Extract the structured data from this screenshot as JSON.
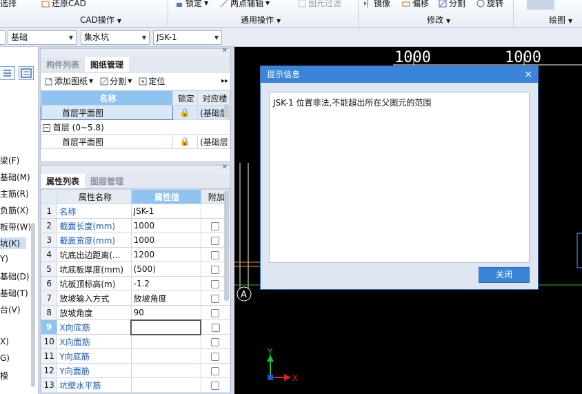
{
  "ribbon": {
    "cad_group": {
      "top_item": "还原CAD",
      "left_fragment": "选择",
      "label": "CAD操作"
    },
    "general_group": {
      "lock": "锁定",
      "two_point_paste": "两点辅轴",
      "element_filter": "图元过滤",
      "label": "通用操作"
    },
    "modify_group": {
      "mirror": "镜像",
      "offset": "偏移",
      "split": "分割",
      "rotate": "旋转",
      "label": "修改"
    },
    "draw_group": {
      "label": "绘图"
    }
  },
  "dropdowns": [
    {
      "value": ""
    },
    {
      "value": "基础"
    },
    {
      "value": "集水坑"
    },
    {
      "value": "JSK-1"
    }
  ],
  "left_tree": {
    "items": [
      "梁(F)",
      "基础(M)",
      "主筋(R)",
      "负筋(X)",
      "板带(W)",
      "坑(K)",
      "Y)",
      "基础(D)",
      "基础(T)",
      "台(V)",
      "X)",
      "G)",
      "模"
    ]
  },
  "drawing_panel": {
    "tabs": [
      "构件列表",
      "图纸管理"
    ],
    "toolbar": {
      "add_drawing": "添加图纸",
      "split": "分割",
      "locate": "定位"
    },
    "columns": [
      "名称",
      "锁定",
      "对应楼"
    ],
    "rows": [
      {
        "name": "首层平面图",
        "lock": "🔒",
        "floor": "(基础层"
      },
      {
        "group": "首层 (0~5.8)"
      },
      {
        "name": "首层平面图",
        "lock": "🔒",
        "floor": "(基础层"
      }
    ]
  },
  "property_panel": {
    "tabs": [
      "属性列表",
      "图层管理"
    ],
    "columns": [
      "属性名称",
      "属性值",
      "附加"
    ],
    "rows": [
      {
        "num": "1",
        "name": "名称",
        "value": "JSK-1",
        "blue": true,
        "check": false
      },
      {
        "num": "2",
        "name": "截面长度(mm)",
        "value": "1000",
        "blue": true,
        "check": true
      },
      {
        "num": "3",
        "name": "截面宽度(mm)",
        "value": "1000",
        "blue": true,
        "check": true
      },
      {
        "num": "4",
        "name": "坑底出边距离(...",
        "value": "1200",
        "blue": false,
        "check": true
      },
      {
        "num": "5",
        "name": "坑底板厚度(mm)",
        "value": "(500)",
        "blue": false,
        "check": true
      },
      {
        "num": "6",
        "name": "坑板顶标高(m)",
        "value": "-1.2",
        "blue": false,
        "check": true
      },
      {
        "num": "7",
        "name": "放坡输入方式",
        "value": "放坡角度",
        "blue": false,
        "check": true
      },
      {
        "num": "8",
        "name": "放坡角度",
        "value": "90",
        "blue": false,
        "check": true
      },
      {
        "num": "9",
        "name": "X向底筋",
        "value": "",
        "blue": true,
        "check": true
      },
      {
        "num": "10",
        "name": "X向面筋",
        "value": "",
        "blue": true,
        "check": true
      },
      {
        "num": "11",
        "name": "Y向底筋",
        "value": "",
        "blue": true,
        "check": true
      },
      {
        "num": "12",
        "name": "Y向面筋",
        "value": "",
        "blue": true,
        "check": true
      },
      {
        "num": "13",
        "name": "坑壁水平筋",
        "value": "",
        "blue": true,
        "check": true
      }
    ]
  },
  "cad": {
    "dim_labels": [
      "1000",
      "1000"
    ],
    "axis_label": "A",
    "ucs": {
      "x": "X",
      "y": "Y"
    },
    "colors": {
      "background": "#000000",
      "lines": "#ffffff",
      "accent": "#e0a030",
      "green": "#20c040",
      "red": "#e02020"
    }
  },
  "dialog": {
    "title": "提示信息",
    "close_glyph": "×",
    "message": "JSK-1 位置非法,不能超出所在父图元的范围",
    "button": "关闭"
  }
}
